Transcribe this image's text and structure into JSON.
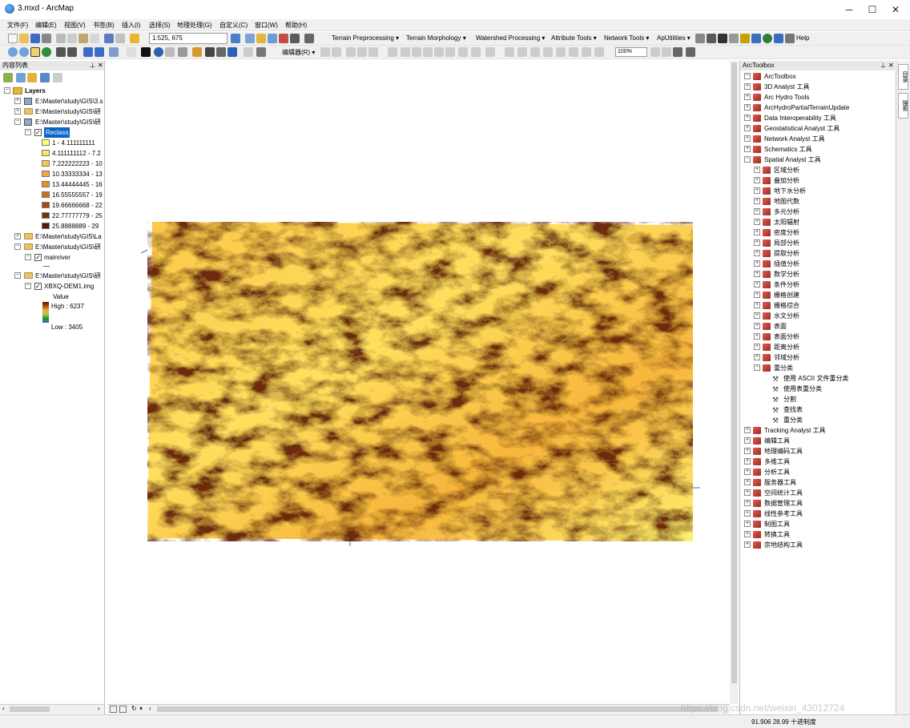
{
  "window": {
    "title": "3.mxd - ArcMap",
    "minimize": "─",
    "maximize": "☐",
    "close": "✕"
  },
  "menu": [
    "文件(F)",
    "编辑(E)",
    "视图(V)",
    "书签(B)",
    "插入(I)",
    "选择(S)",
    "地理处理(G)",
    "自定义(C)",
    "窗口(W)",
    "帮助(H)"
  ],
  "toolbar1": {
    "scale": "1:525, 675",
    "items": [
      "Terrain Preprocessing ▾",
      "Terrain Morphology ▾",
      "Watershed Processing ▾",
      "Attribute Tools ▾",
      "Network Tools ▾",
      "ApUtilities ▾",
      "Help"
    ]
  },
  "toolbar2": {
    "editor": "编辑器(R) ▾",
    "zoom": "100%"
  },
  "toc": {
    "title": "内容列表",
    "pin": "⊥",
    "close": "✕",
    "layers_label": "Layers",
    "paths": [
      "E:\\Master\\study\\GIS\\3.s",
      "E:\\Master\\study\\GIS\\研",
      "E:\\Master\\study\\GIS\\研"
    ],
    "reclass_name": "Reclass",
    "reclass_classes": [
      {
        "label": "1 - 4.111111111",
        "color": "#ffff73"
      },
      {
        "label": "4.111111112 - 7.2",
        "color": "#ffe35c"
      },
      {
        "label": "7.222222223 - 10",
        "color": "#fcc545"
      },
      {
        "label": "10.33333334 - 13",
        "color": "#f3a934"
      },
      {
        "label": "13.44444445 - 16",
        "color": "#e88f26"
      },
      {
        "label": "16.55555557 - 19",
        "color": "#cd6f1a"
      },
      {
        "label": "19.66666668 - 22",
        "color": "#a84c12"
      },
      {
        "label": "22.77777779 - 25",
        "color": "#7e2f0b"
      },
      {
        "label": "25.8888889 - 29",
        "color": "#5a1a07"
      }
    ],
    "paths2": [
      "E:\\Master\\study\\GIS\\La",
      "E:\\Master\\study\\GIS\\研"
    ],
    "mainriver": "mainriver",
    "path3": "E:\\Master\\study\\GIS\\研",
    "dem_name": "XBXQ-DEM1.img",
    "dem_value_label": "Value",
    "dem_high": "High : 6237",
    "dem_low": "Low : 3405"
  },
  "toolbox": {
    "title": "ArcToolbox",
    "pin": "⊥",
    "close": "✕",
    "root": "ArcToolbox",
    "top_items": [
      "3D Analyst 工具",
      "Arc Hydro Tools",
      "ArcHydroPartialTerrainUpdate",
      "Data Interoperability 工具",
      "Geostatistical Analyst 工具",
      "Network Analyst 工具",
      "Schematics 工具",
      "Spatial Analyst 工具"
    ],
    "spatial_children": [
      "区域分析",
      "叠加分析",
      "地下水分析",
      "地图代数",
      "多元分析",
      "太阳辐射",
      "密度分析",
      "局部分析",
      "提取分析",
      "插值分析",
      "数学分析",
      "条件分析",
      "栅格创建",
      "栅格综合",
      "水文分析",
      "表面",
      "表面分析",
      "距离分析",
      "邻域分析",
      "重分类"
    ],
    "reclass_tools": [
      "使用 ASCII 文件重分类",
      "使用表重分类",
      "分割",
      "查找表",
      "重分类"
    ],
    "bottom_items": [
      "Tracking Analyst 工具",
      "编辑工具",
      "地理编码工具",
      "多维工具",
      "分析工具",
      "服务器工具",
      "空间统计工具",
      "数据管理工具",
      "线性参考工具",
      "制图工具",
      "转换工具",
      "宗地结构工具"
    ]
  },
  "side_tabs": [
    "目录",
    "搜索"
  ],
  "status": {
    "coords": "91.906  28.99 十进制度"
  },
  "watermark": "https://blog.csdn.net/weixin_43012724"
}
